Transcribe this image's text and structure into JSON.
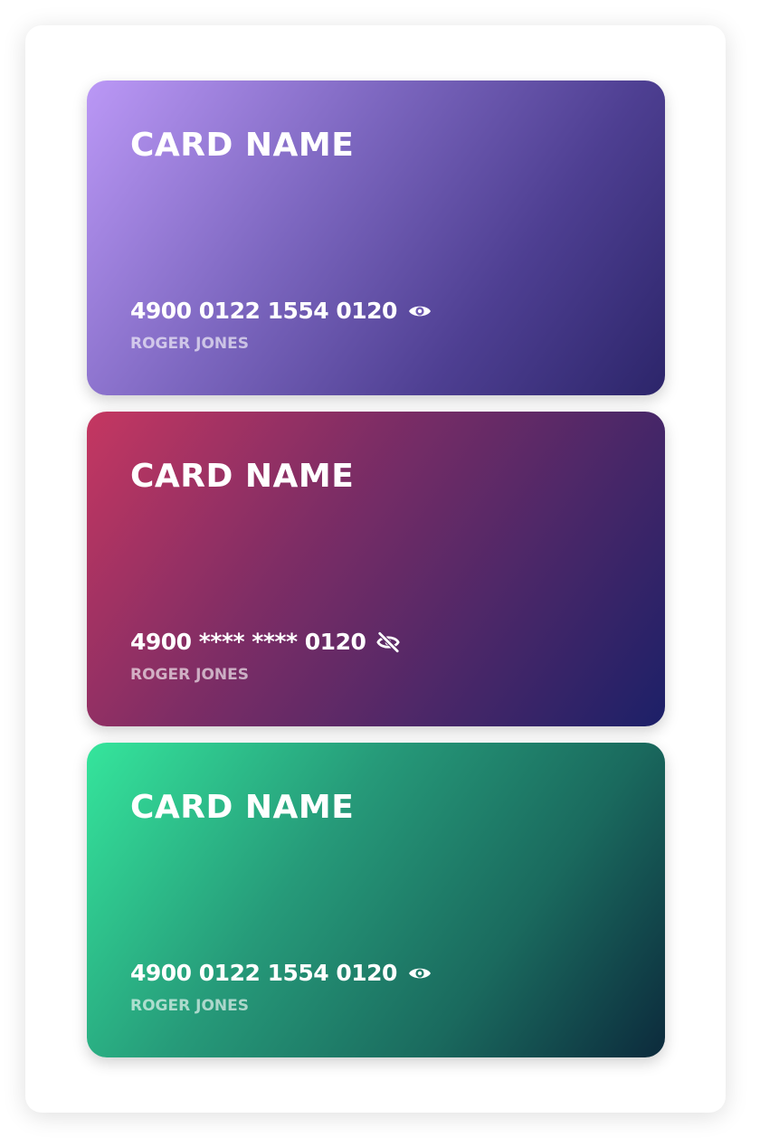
{
  "cards": [
    {
      "title": "CARD NAME",
      "number": "4900 0122 1554 0120",
      "holder": "ROGER JONES",
      "visibility_icon": "eye-icon",
      "gradient": [
        "#bb98f6",
        "#2c256a"
      ]
    },
    {
      "title": "CARD NAME",
      "number": "4900 **** **** 0120",
      "holder": "ROGER JONES",
      "visibility_icon": "eye-off-icon",
      "gradient": [
        "#c53761",
        "#1c2068"
      ]
    },
    {
      "title": "CARD NAME",
      "number": "4900 0122 1554 0120",
      "holder": "ROGER JONES",
      "visibility_icon": "eye-icon",
      "gradient": [
        "#35e59c",
        "#0c2a3c"
      ]
    }
  ]
}
